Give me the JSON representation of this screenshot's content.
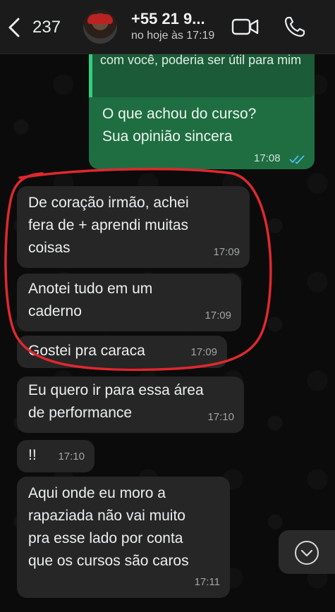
{
  "header": {
    "back_count": "237",
    "contact_name": "+55 21 9...",
    "contact_status": "no hoje às 17:19"
  },
  "messages": {
    "quoted_text": "com você, poderia ser útil para mim",
    "outgoing": [
      {
        "text": "O que achou do curso?\nSua opinião sincera",
        "time": "17:08",
        "status": "read"
      }
    ],
    "incoming": [
      {
        "text": "De coração irmão, achei\nfera de + aprendi muitas\ncoisas",
        "time": "17:09"
      },
      {
        "text": "Anotei tudo em um\ncaderno",
        "time": "17:09"
      },
      {
        "text": "Gostei pra caraca",
        "time": "17:09"
      },
      {
        "text": "Eu quero ir para essa área\nde performance",
        "time": "17:10"
      },
      {
        "text": "!!",
        "time": "17:10"
      },
      {
        "text": "Aqui onde eu moro a\nrapaziada não vai muito\npra esse lado por conta\nque os cursos são caros",
        "time": "17:11"
      }
    ]
  },
  "colors": {
    "outgoing_bubble": "#1f6e42",
    "incoming_bubble": "#262626",
    "read_ticks": "#53bdeb",
    "annotation_circle": "#e0282e"
  },
  "icons": [
    "back-chevron-icon",
    "video-call-icon",
    "phone-call-icon",
    "double-check-icon",
    "scroll-down-icon"
  ]
}
